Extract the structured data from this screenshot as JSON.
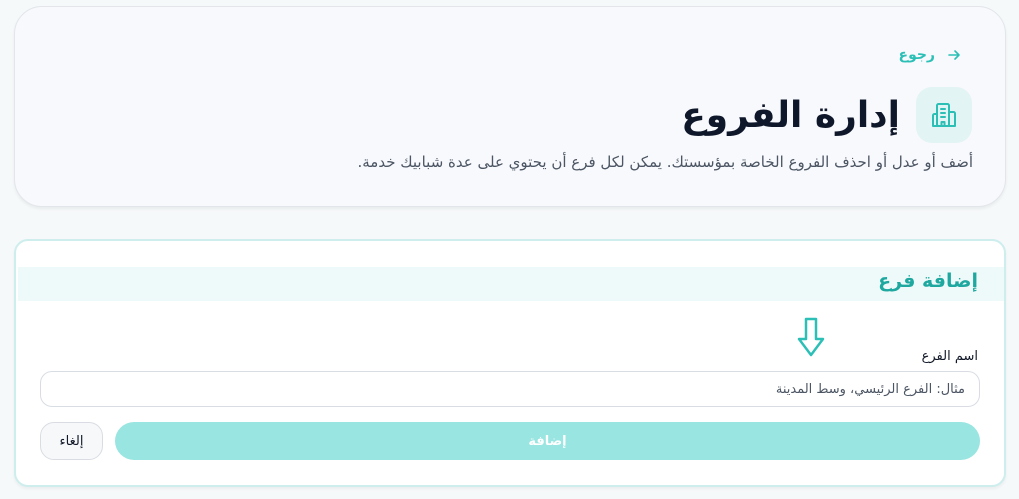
{
  "header": {
    "back_label": "رجوع",
    "title": "إدارة الفروع",
    "subtitle": "أضف أو عدل أو احذف الفروع الخاصة بمؤسستك. يمكن لكل فرع أن يحتوي على عدة شبابيك خدمة."
  },
  "form": {
    "title": "إضافة فرع",
    "name_label": "اسم الفرع",
    "name_value": "",
    "name_placeholder": "مثال: الفرع الرئيسي، وسط المدينة",
    "add_label": "إضافة",
    "cancel_label": "إلغاء"
  },
  "icons": {
    "back": "arrow-right-icon",
    "title": "building-icon",
    "hint": "arrow-down-icon"
  },
  "colors": {
    "accent": "#2bbfb6",
    "accent_light": "#99e5e1",
    "title_icon_bg": "#e3f4f4",
    "form_header_bg": "#eefaf9"
  }
}
